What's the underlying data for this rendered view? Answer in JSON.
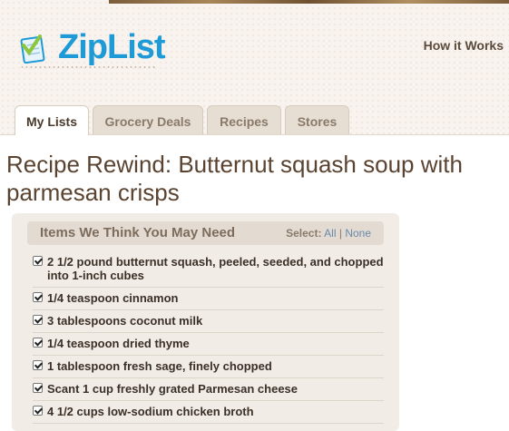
{
  "brand": {
    "name": "ZipList"
  },
  "header": {
    "how_it_works": "How it Works"
  },
  "tabs": [
    {
      "label": "My Lists",
      "active": true
    },
    {
      "label": "Grocery Deals",
      "active": false
    },
    {
      "label": "Recipes",
      "active": false
    },
    {
      "label": "Stores",
      "active": false
    }
  ],
  "page": {
    "title": "Recipe Rewind: Butternut squash soup with parmesan crisps"
  },
  "panel": {
    "title": "Items We Think You May Need",
    "select_label": "Select:",
    "select_all": "All",
    "separator": "|",
    "select_none": "None",
    "items": [
      {
        "text": "2 1/2 pound butternut squash, peeled, seeded, and chopped into 1-inch cubes",
        "checked": true
      },
      {
        "text": "1/4 teaspoon cinnamon",
        "checked": true
      },
      {
        "text": "3 tablespoons coconut milk",
        "checked": true
      },
      {
        "text": "1/4 teaspoon dried thyme",
        "checked": true
      },
      {
        "text": "1 tablespoon fresh sage, finely chopped",
        "checked": true
      },
      {
        "text": "Scant 1 cup freshly grated Parmesan cheese",
        "checked": true
      },
      {
        "text": "4 1/2 cups low-sodium chicken broth",
        "checked": true
      }
    ]
  },
  "colors": {
    "brand_blue": "#1e9ad6",
    "title_brown": "#5a4330"
  }
}
